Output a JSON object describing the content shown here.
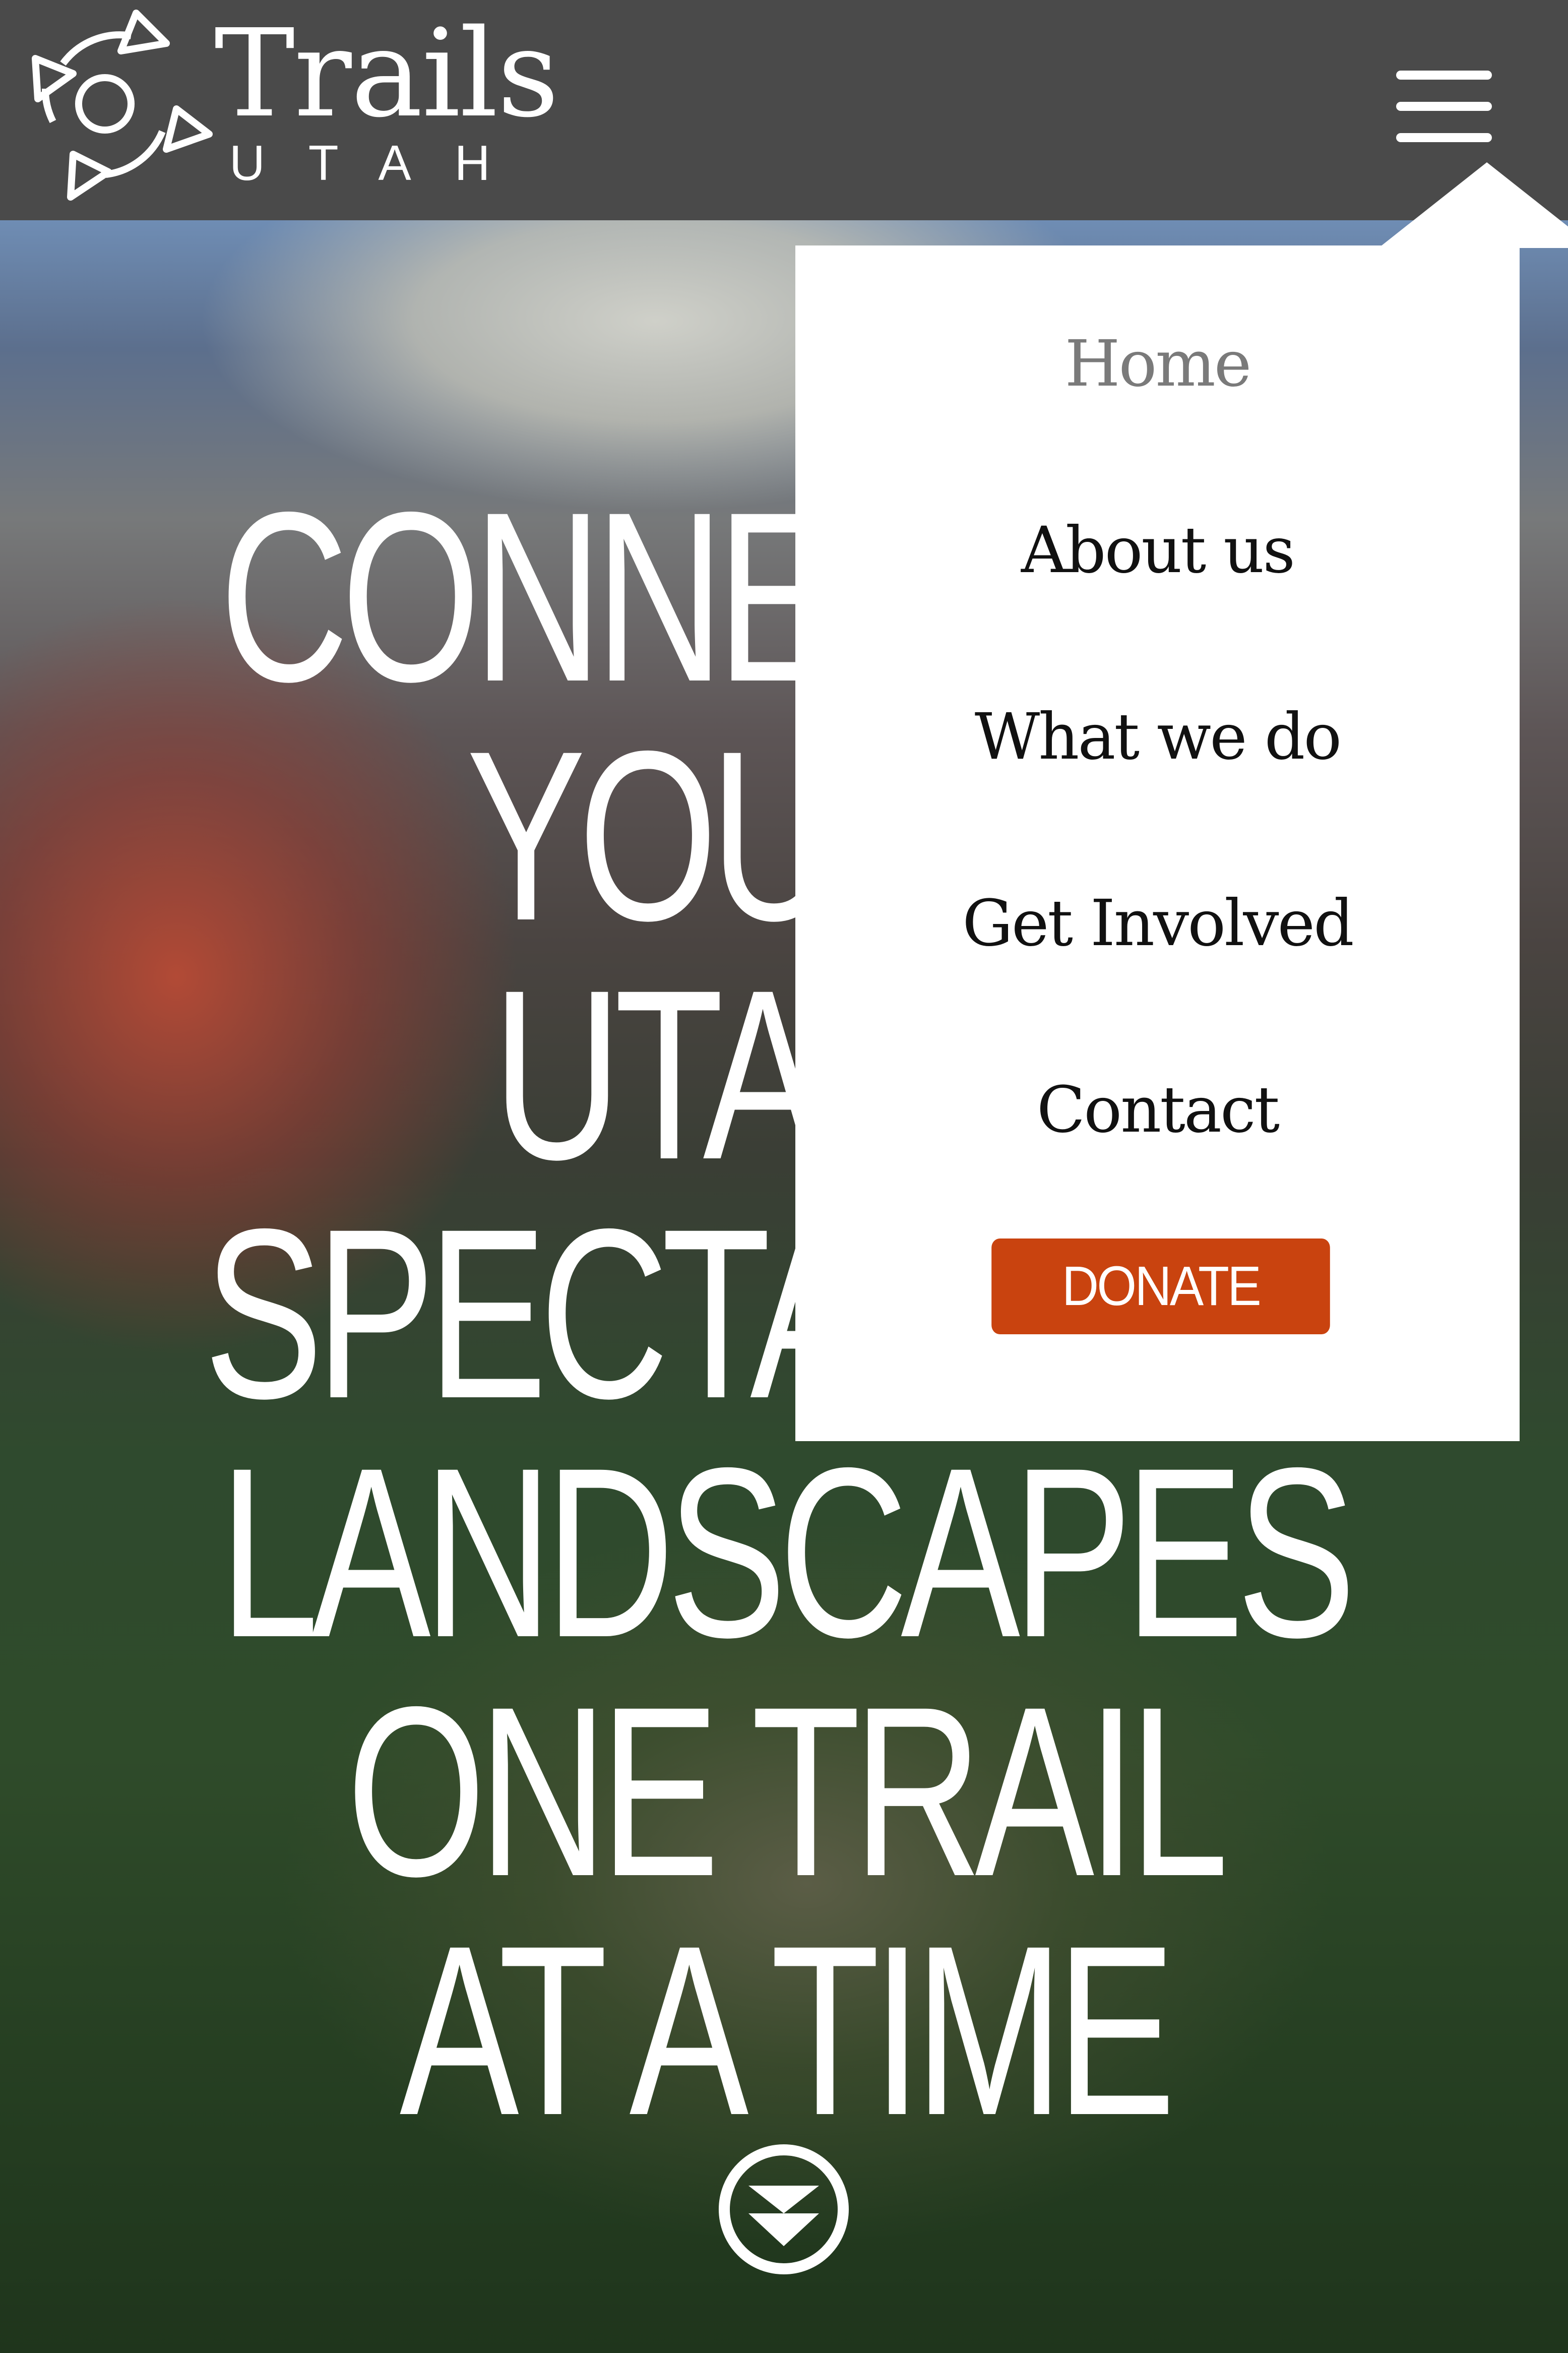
{
  "header": {
    "logo_word": "Trails",
    "logo_sub": "UTAH",
    "menu_icon": "hamburger-menu-icon"
  },
  "hero": {
    "title_lines": [
      "CONNECTING",
      "YOU TO UTAH'S",
      "SPECTACULAR",
      "LANDSCAPES",
      "ONE TRAIL",
      "AT A TIME"
    ],
    "scroll_icon": "scroll-down-icon"
  },
  "menu": {
    "items": [
      {
        "label": "Home",
        "active": true
      },
      {
        "label": "About us"
      },
      {
        "label": "What we do"
      },
      {
        "label": "Get Involved"
      },
      {
        "label": "Contact"
      }
    ],
    "donate_label": "DONATE"
  },
  "colors": {
    "header_bg": "#4a4a4a",
    "donate_bg": "#c9430f",
    "menu_bg": "#ffffff",
    "active_item": "#7a7a7a"
  }
}
